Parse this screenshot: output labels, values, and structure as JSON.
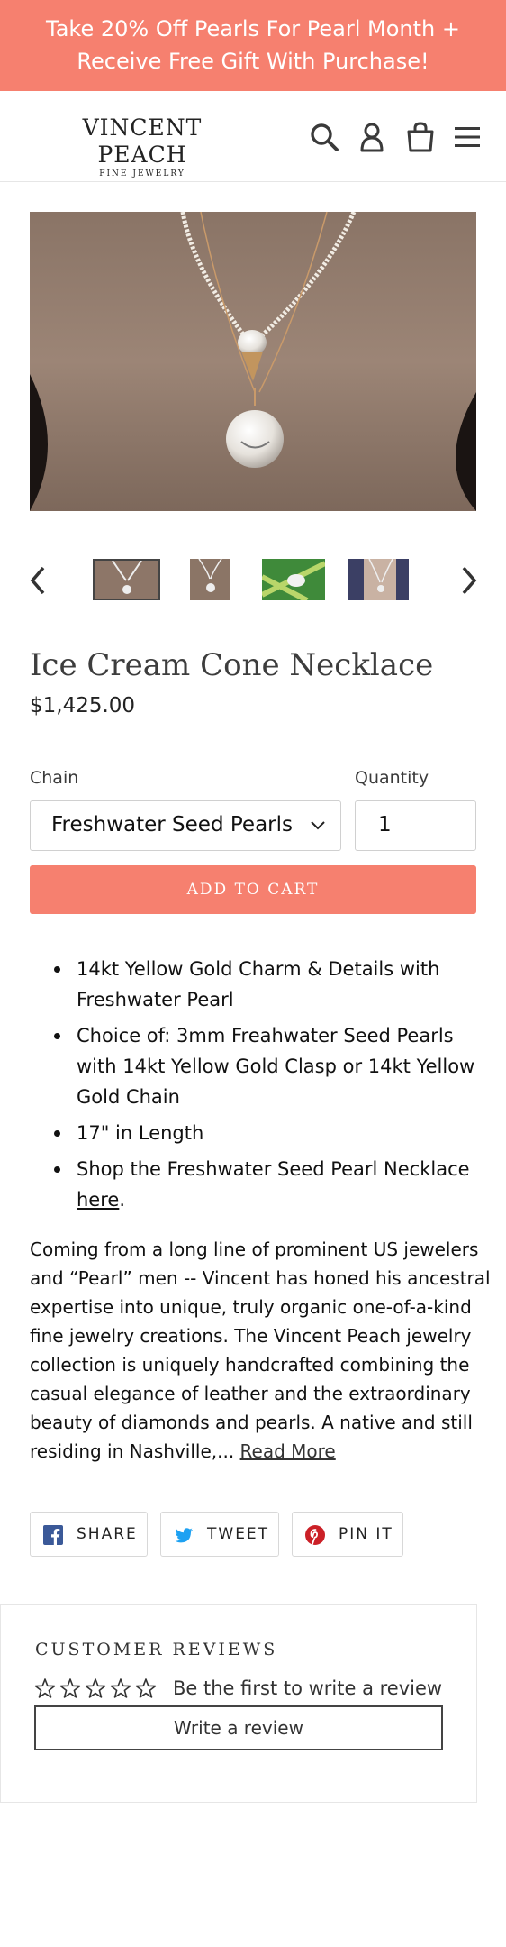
{
  "announcement": {
    "line1": "Take 20% Off Pearls For Pearl Month +",
    "line2": "Receive Free Gift With Purchase!"
  },
  "header": {
    "logo_main": "VINCENT PEACH",
    "logo_sub": "FINE JEWELRY",
    "icons": [
      "search-icon",
      "account-icon",
      "cart-icon",
      "menu-icon"
    ]
  },
  "product": {
    "title": "Ice Cream Cone Necklace",
    "price": "$1,425.00",
    "chain_label": "Chain",
    "chain_value": "Freshwater Seed Pearls",
    "quantity_label": "Quantity",
    "quantity_value": "1",
    "add_to_cart": "ADD TO CART"
  },
  "features": {
    "item1": "14kt Yellow Gold Charm & Details with Freshwater Pearl",
    "item2": "Choice of: 3mm Freahwater Seed Pearls with 14kt Yellow Gold Clasp or 14kt Yellow Gold Chain",
    "item3": "17\" in Length",
    "item4_text": "Shop the Freshwater Seed Pearl Necklace",
    "item4_link": "here",
    "item4_end": "."
  },
  "description": {
    "line1": "Coming from a long line of prominent US jewelers",
    "line2": "and “Pearl” men -- Vincent has honed his ancestral",
    "line3": "expertise into unique, truly organic one-of-a-kind",
    "line4": "fine jewelry creations. The Vincent Peach jewelry",
    "line5": "collection is uniquely handcrafted combining the",
    "line6": "casual elegance of leather and the extraordinary",
    "line7": "beauty of diamonds and pearls. A native and still",
    "line8": "residing in Nashville,... ",
    "read_more": "Read More"
  },
  "share": {
    "facebook": "SHARE",
    "twitter": "TWEET",
    "pinterest": "PIN IT"
  },
  "reviews": {
    "title": "CUSTOMER REVIEWS",
    "empty_text": "Be the first to write a review",
    "write_button": "Write a review"
  },
  "colors": {
    "accent": "#f6806f",
    "facebook": "#3b5998",
    "twitter": "#1da1f2",
    "pinterest": "#cb2027"
  }
}
